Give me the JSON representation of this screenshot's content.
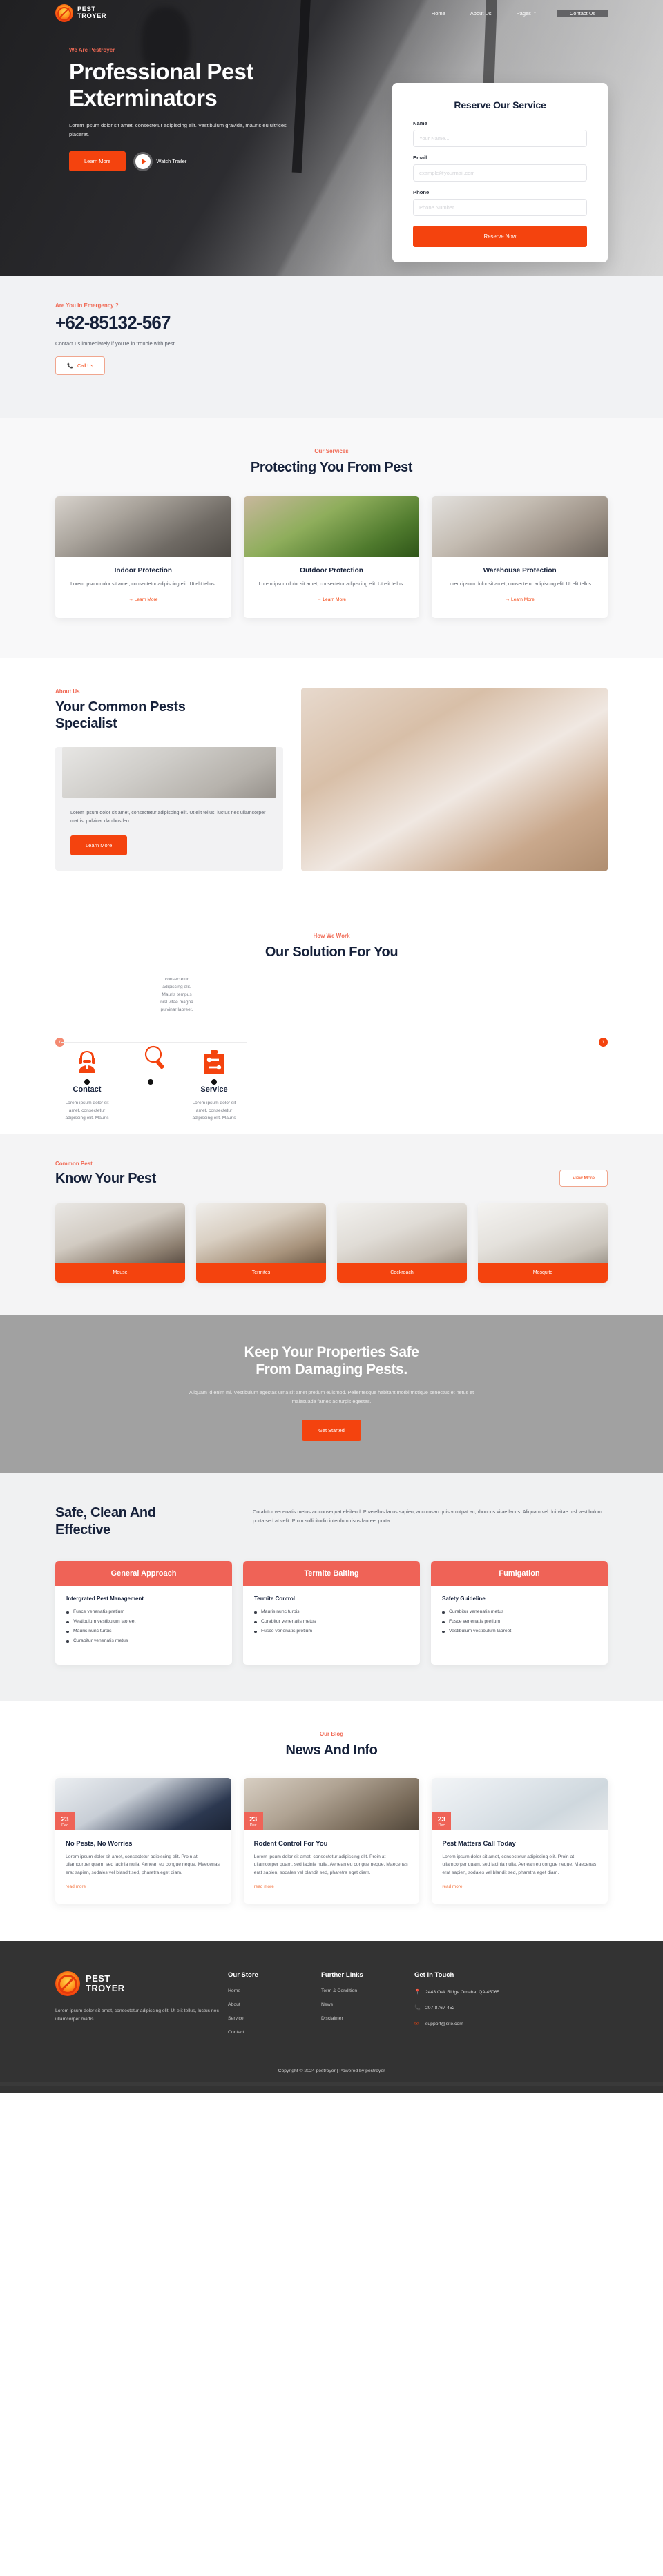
{
  "brand": {
    "line1": "PEST",
    "line2": "TROYER",
    "logo_icon": "pest-logo-icon"
  },
  "nav": {
    "items": [
      {
        "label": "Home",
        "icon": null
      },
      {
        "label": "About Us",
        "icon": null
      },
      {
        "label": "Pages",
        "icon": "chevron-down-icon"
      }
    ],
    "contact_label": "Contact Us"
  },
  "hero": {
    "eyebrow": "We Are Pestroyer",
    "title_line1": "Professional Pest",
    "title_line2": "Exterminators",
    "subtitle": "Lorem ipsum dolor sit amet, consectetur adipiscing elit. Vestibulum gravida, mauris eu ultrices placerat.",
    "primary_button": "Learn More",
    "play_icon": "play-icon",
    "video_label": "Watch Trailer"
  },
  "reserve": {
    "title": "Reserve Our Service",
    "name_label": "Name",
    "name_placeholder": "Your Name...",
    "email_label": "Email",
    "email_placeholder": "example@yourmail.com",
    "phone_label": "Phone",
    "phone_placeholder": "Phone Number...",
    "submit_label": "Reserve Now"
  },
  "emergency": {
    "eyebrow": "Are You In Emergency ?",
    "phone": "+62-85132-567",
    "text": "Contact us immediately if you're in trouble with pest.",
    "button_label": "Call Us",
    "button_icon": "phone-icon"
  },
  "services": {
    "eyebrow": "Our Services",
    "title": "Protecting You From Pest",
    "link_icon": "arrow-right-icon",
    "cards": [
      {
        "name": "Indoor Protection",
        "desc": "Lorem ipsum dolor sit amet, consectetur adipiscing elit. Ut elit tellus.",
        "link": "Learn More"
      },
      {
        "name": "Outdoor Protection",
        "desc": "Lorem ipsum dolor sit amet, consectetur adipiscing elit. Ut elit tellus.",
        "link": "Learn More"
      },
      {
        "name": "Warehouse Protection",
        "desc": "Lorem ipsum dolor sit amet, consectetur adipiscing elit. Ut elit tellus.",
        "link": "Learn More"
      }
    ]
  },
  "about": {
    "eyebrow": "About Us",
    "title_line1": "Your Common Pests",
    "title_line2": "Specialist",
    "text": "Lorem ipsum dolor sit amet, consectetur adipiscing elit. Ut elit tellus, luctus nec ullamcorper mattis, pulvinar dapibus leo.",
    "button_label": "Learn More"
  },
  "solution": {
    "eyebrow": "How We Work",
    "title": "Our Solution For You",
    "overlap_text": "consectetur adipiscing elit. Mauris tempus nisl vitae magna pulvinar laoreet.",
    "prev_icon": "chevron-left-icon",
    "next_icon": "chevron-right-icon",
    "steps": [
      {
        "name": "Contact",
        "icon": "support-agent-icon",
        "desc": "Lorem ipsum dolor sit amet, consectetur adipiscing elit. Mauris"
      },
      {
        "name": "Service",
        "icon": "toolbox-icon",
        "desc": "Lorem ipsum dolor sit amet, consectetur adipiscing elit. Mauris"
      }
    ],
    "middle_icon": "magnifier-icon"
  },
  "pests": {
    "eyebrow": "Common Pest",
    "title": "Know Your Pest",
    "view_more": "View More",
    "items": [
      {
        "label": "Mouse"
      },
      {
        "label": "Termites"
      },
      {
        "label": "Cockroach"
      },
      {
        "label": "Mosquito"
      }
    ]
  },
  "cta": {
    "title_line1": "Keep Your Properties Safe",
    "title_line2": "From Damaging Pests.",
    "text": "Aliquam id enim mi. Vestibulum egestas urna sit amet pretium euismod. Pellentesque habitant morbi tristique senectus et netus et malesuada fames ac turpis egestas.",
    "button_label": "Get Started"
  },
  "safe": {
    "title_line1": "Safe, Clean And",
    "title_line2": "Effective",
    "text": "Curabitur venenatis metus ac consequat eleifend. Phasellus lacus sapien, accumsan quis volutpat ac, rhoncus vitae lacus. Aliquam vel dui vitae nisl vestibulum porta sed at velit. Proin sollicitudin interdum risus laoreet porta.",
    "plans": [
      {
        "head": "General Approach",
        "sub": "Intergrated Pest Management",
        "items": [
          "Fusce venenatis pretium",
          "Vestibulum vestibulum laoreet",
          "Mauris nunc turpis",
          "Curabitur venenatis metus"
        ]
      },
      {
        "head": "Termite Baiting",
        "sub": "Termite Control",
        "items": [
          "Mauris nunc turpis",
          "Curabitur venenatis metus",
          "Fusce venenatis pretium"
        ]
      },
      {
        "head": "Fumigation",
        "sub": "Safety Guideline",
        "items": [
          "Curabitur venenatis metus",
          "Fusce venenatis pretium",
          "Vestibulum vestibulum laoreet"
        ]
      }
    ]
  },
  "blog": {
    "eyebrow": "Our Blog",
    "title": "News And Info",
    "posts": [
      {
        "day": "23",
        "month": "Dec",
        "title": "No Pests, No Worries",
        "text": "Lorem ipsum dolor sit amet, consectetur adipiscing elit. Proin at ullamcorper quam, sed lacinia nulla. Aenean eu congue neque. Maecenas erat sapien, sodales vel blandit sed, pharetra eget diam.",
        "more": "read more"
      },
      {
        "day": "23",
        "month": "Dec",
        "title": "Rodent Control For You",
        "text": "Lorem ipsum dolor sit amet, consectetur adipiscing elit. Proin at ullamcorper quam, sed lacinia nulla. Aenean eu congue neque. Maecenas erat sapien, sodales vel blandit sed, pharetra eget diam.",
        "more": "read more"
      },
      {
        "day": "23",
        "month": "Dec",
        "title": "Pest Matters Call Today",
        "text": "Lorem ipsum dolor sit amet, consectetur adipiscing elit. Proin at ullamcorper quam, sed lacinia nulla. Aenean eu congue neque. Maecenas erat sapien, sodales vel blandit sed, pharetra eget diam.",
        "more": "read more"
      }
    ]
  },
  "footer": {
    "desc": "Lorem ipsum dolor sit amet, consectetur adipiscing elit. Ut elit tellus, luctus nec ullamcorper mattis.",
    "store": {
      "heading": "Our Store",
      "links": [
        "Home",
        "About",
        "Service",
        "Contact"
      ]
    },
    "further": {
      "heading": "Further Links",
      "links": [
        "Term & Condition",
        "News",
        "Disclaimer"
      ]
    },
    "touch": {
      "heading": "Get In Touch",
      "address": "2443 Oak Ridge Omaha, QA 45065",
      "address_icon": "location-pin-icon",
      "phone": "207-8767-452",
      "phone_icon": "phone-icon",
      "email": "support@site.com",
      "email_icon": "envelope-icon"
    },
    "copyright": "Copyright © 2024 pestroyer | Powered by pestroyer"
  },
  "colors": {
    "accent": "#f4430e",
    "accent_soft": "#ef6357",
    "dark": "#16213a",
    "footer_bg": "#333333"
  }
}
